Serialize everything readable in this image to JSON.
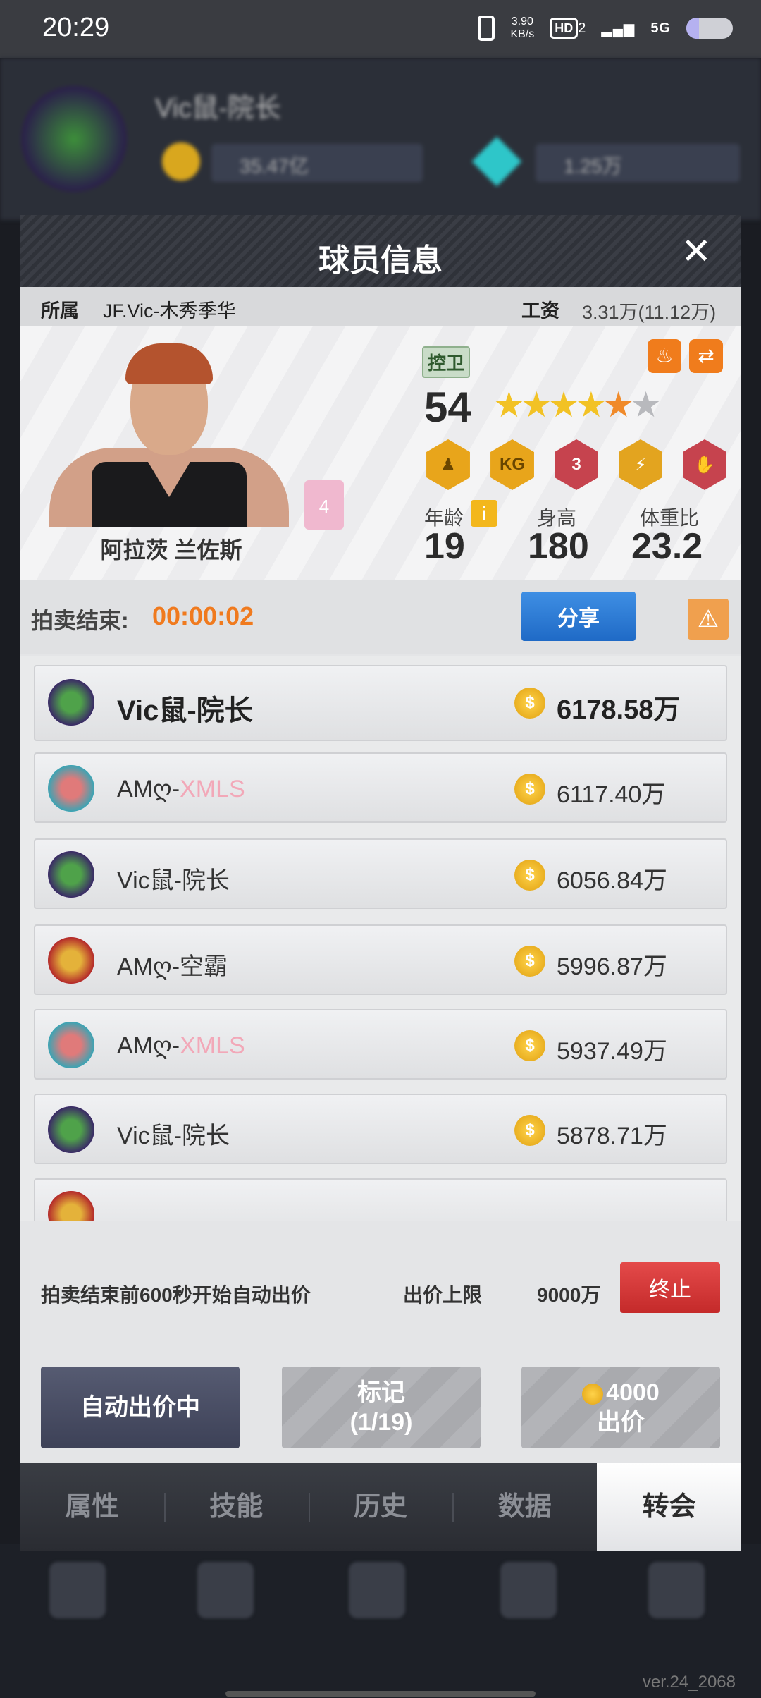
{
  "status_bar": {
    "time": "20:29",
    "net_speed_value": "3.90",
    "net_speed_unit": "KB/s",
    "hd_label": "HD",
    "hd_sub": "2",
    "signal_label": "5G"
  },
  "background": {
    "player_name": "Vic鼠-院长",
    "coin_value": "35.47亿",
    "gem_value": "1.25万",
    "version": "ver.24_2068"
  },
  "modal": {
    "title": "球员信息",
    "close_icon": "close-icon",
    "team_label": "所属",
    "team_value": "JF.Vic-木秀季华",
    "salary_label": "工资",
    "salary_value": "3.31万(11.12万)",
    "player": {
      "name": "阿拉茨 兰佐斯",
      "position": "控卫",
      "jersey_number": "4",
      "rating": "54",
      "stars": 4.5,
      "age_label": "年龄",
      "age": "19",
      "height_label": "身高",
      "height": "180",
      "weight_label": "体重比",
      "weight": "23.2",
      "badges": [
        {
          "icon": "player-silhouette-badge-icon"
        },
        {
          "icon": "kg-badge-icon",
          "text": "KG"
        },
        {
          "icon": "three-point-badge-icon",
          "text": "3"
        },
        {
          "icon": "lightning-badge-icon"
        },
        {
          "icon": "dunk-badge-icon"
        }
      ]
    },
    "auction": {
      "label": "拍卖结束:",
      "countdown": "00:00:02",
      "share_label": "分享"
    },
    "bids": [
      {
        "name": "Vic鼠-院长",
        "name_suffix": "",
        "amount": "6178.58万"
      },
      {
        "name": "AMღ-",
        "name_suffix": "XMLS",
        "amount": "6117.40万"
      },
      {
        "name": "Vic鼠-院长",
        "name_suffix": "",
        "amount": "6056.84万"
      },
      {
        "name": "AMღ-空霸",
        "name_suffix": "",
        "amount": "5996.87万"
      },
      {
        "name": "AMღ-",
        "name_suffix": "XMLS",
        "amount": "5937.49万"
      },
      {
        "name": "Vic鼠-院长",
        "name_suffix": "",
        "amount": "5878.71万"
      }
    ],
    "auto_bid": {
      "text": "拍卖结束前600秒开始自动出价",
      "limit_label": "出价上限",
      "limit_value": "9000万",
      "stop_label": "终止"
    },
    "buttons": {
      "auto_label": "自动出价中",
      "mark_label": "标记",
      "mark_count": "(1/19)",
      "bid_amount": "4000",
      "bid_label": "出价"
    },
    "tabs": [
      "属性",
      "技能",
      "历史",
      "数据",
      "转会"
    ],
    "active_tab": "转会"
  },
  "colors": {
    "countdown": "#f07a1e",
    "share_button": "#2a78d3",
    "stop_button": "#d43a3a",
    "accent_coin": "#f0b020"
  }
}
